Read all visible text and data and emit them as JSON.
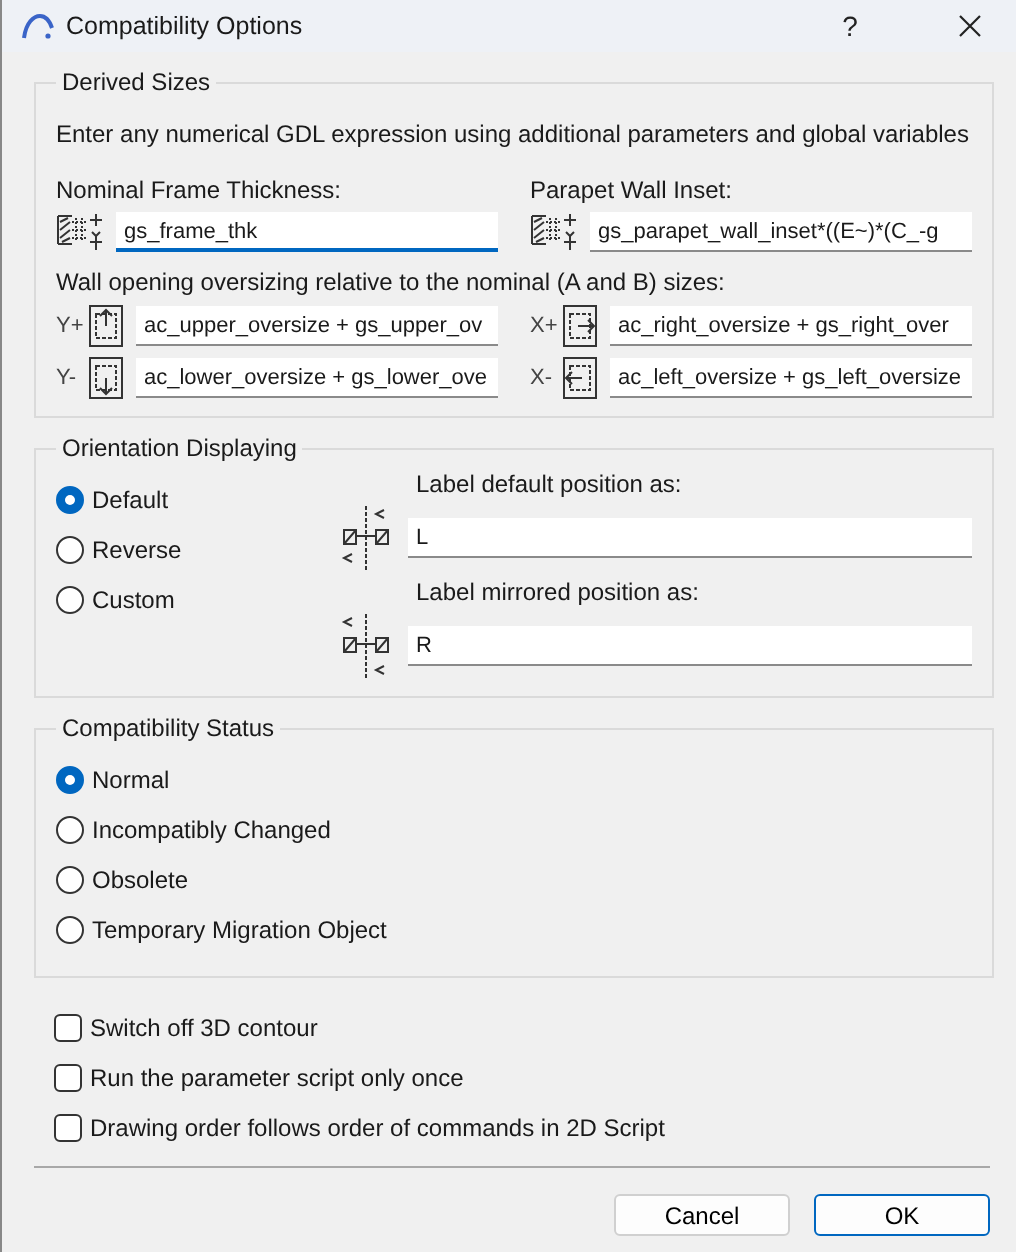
{
  "window": {
    "title": "Compatibility Options",
    "help": "?"
  },
  "derived_sizes": {
    "title": "Derived Sizes",
    "description": "Enter any numerical GDL expression using additional parameters and global variables",
    "frame_thickness": {
      "label": "Nominal Frame Thickness:",
      "value": "gs_frame_thk",
      "focused": true
    },
    "parapet_inset": {
      "label": "Parapet Wall Inset:",
      "value": "gs_parapet_wall_inset*((E~)*(C_-g",
      "focused": false
    },
    "oversizing_label": "Wall opening oversizing relative to the nominal (A and B) sizes:",
    "oversize_fields": [
      {
        "axis": "Y+",
        "kind": "up",
        "value": "ac_upper_oversize + gs_upper_ov",
        "focused": false
      },
      {
        "axis": "X+",
        "kind": "right",
        "value": "ac_right_oversize + gs_right_over",
        "focused": false
      },
      {
        "axis": "Y-",
        "kind": "down",
        "value": "ac_lower_oversize + gs_lower_ove",
        "focused": false
      },
      {
        "axis": "X-",
        "kind": "left",
        "value": "ac_left_oversize + gs_left_oversize",
        "focused": false
      }
    ]
  },
  "orientation": {
    "title": "Orientation Displaying",
    "options": [
      {
        "label": "Default",
        "selected": true
      },
      {
        "label": "Reverse",
        "selected": false
      },
      {
        "label": "Custom",
        "selected": false
      }
    ],
    "label_default": {
      "label": "Label default position as:",
      "value": "L"
    },
    "label_mirrored": {
      "label": "Label mirrored position as:",
      "value": "R"
    }
  },
  "compatibility_status": {
    "title": "Compatibility Status",
    "options": [
      {
        "label": "Normal",
        "selected": true
      },
      {
        "label": "Incompatibly Changed",
        "selected": false
      },
      {
        "label": "Obsolete",
        "selected": false
      },
      {
        "label": "Temporary Migration Object",
        "selected": false
      }
    ]
  },
  "checkboxes": [
    {
      "label": "Switch off 3D contour",
      "checked": false
    },
    {
      "label": "Run the parameter script only once",
      "checked": false
    },
    {
      "label": "Drawing order follows order of commands in 2D Script",
      "checked": false
    }
  ],
  "buttons": [
    {
      "label": "Cancel",
      "default": false
    },
    {
      "label": "OK",
      "default": true
    }
  ]
}
